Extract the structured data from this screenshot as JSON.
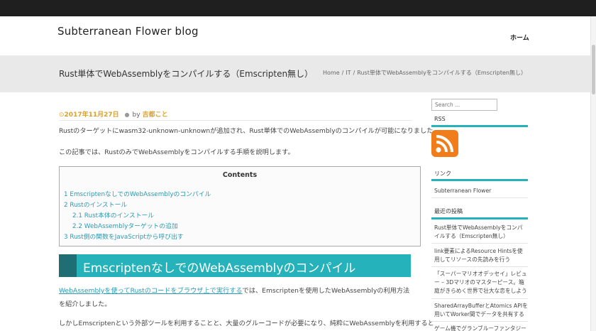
{
  "header": {
    "site_title": "Subterranean Flower blog",
    "nav_home": "ホーム"
  },
  "titlebar": {
    "page_title": "Rust単体でWebAssemblyをコンパイルする（Emscripten無し）",
    "breadcrumb": [
      "Home",
      "IT",
      "Rust単体でWebAssemblyをコンパイルする（Emscripten無し）"
    ],
    "breadcrumb_sep": "/"
  },
  "article": {
    "date": "2017年11月27日",
    "by": "by",
    "author": "吉都こと",
    "p1": "Rustのターゲットにwasm32-unknown-unknownが追加され、Rust単体でのWebAssemblyのコンパイルが可能になりました。",
    "p2": "この記事では、RustのみでWebAssemblyをコンパイルする手順を説明します。",
    "toc": {
      "title": "Contents",
      "items": [
        "1 EmscriptenなしでのWebAssemblyのコンパイル",
        "2 Rustのインストール",
        "2.1 Rust本体のインストール",
        "2.2 WebAssemblyターゲットの追加",
        "3 Rust側の関数をJavaScriptから呼び出す"
      ]
    },
    "h2": "EmscriptenなしでのWebAssemblyのコンパイル",
    "p3_link": "WebAssemblyを使ってRustのコードをブラウザ上で実行する",
    "p3_rest": "では、Emscriptenを使用したWebAssemblyの利用方法を紹介しました。",
    "p4": "しかしEmscriptenという外部ツールを利用することと、大量のグルーコードが必要になり、純粋にWebAssemblyを利用すると"
  },
  "sidebar": {
    "search_placeholder": "Search ...",
    "rss_title": "RSS",
    "links_title": "リンク",
    "link_item": "Subterranean Flower",
    "recent_title": "最近の投稿",
    "recent": [
      "Rust単体でWebAssemblyをコンパイルする（Emscripten無し）",
      "link要素によるResource Hintsを使用してリソースの先読みを行う",
      "「スーパーマリオオデッセイ」レビュー – 3Dマリオのマスターピース。箱庭がきらめく世界で壮大な恋をしよう",
      "SharedArrayBufferとAtomics APIを用いてWorker間でデータを共有する",
      "ゲーム機でグランブルーファンタジー"
    ]
  },
  "colors": {
    "accent": "#26b2ba",
    "accent_dark": "#1e6e74",
    "link": "#2a9ab0",
    "meta": "#d9a030",
    "rss": "#f07d1a"
  }
}
